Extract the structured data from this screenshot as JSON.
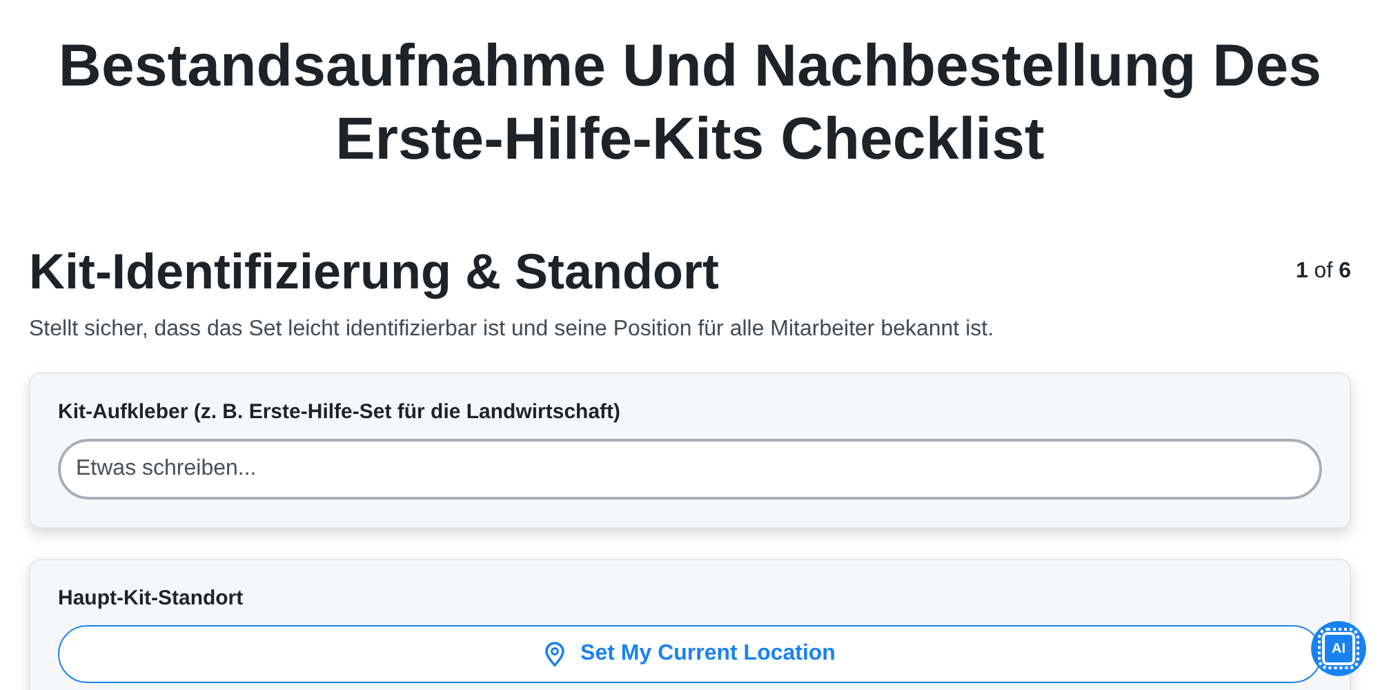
{
  "title": "Bestandsaufnahme Und Nachbestellung Des Erste-Hilfe-Kits Checklist",
  "section": {
    "heading": "Kit-Identifizierung & Standort",
    "step": "**1** of **6**",
    "description": "Stellt sicher, dass das Set leicht identifizierbar ist und seine Position für alle Mitarbeiter bekannt ist."
  },
  "fields": [
    {
      "kind": "text",
      "label": "Kit-Aufkleber (z. B. Erste-Hilfe-Set für die Landwirtschaft)",
      "placeholder": "Etwas schreiben..."
    },
    {
      "kind": "location",
      "label": "Haupt-Kit-Standort",
      "button": "Set My Current Location"
    }
  ],
  "ai_button": {
    "label": "AI"
  }
}
